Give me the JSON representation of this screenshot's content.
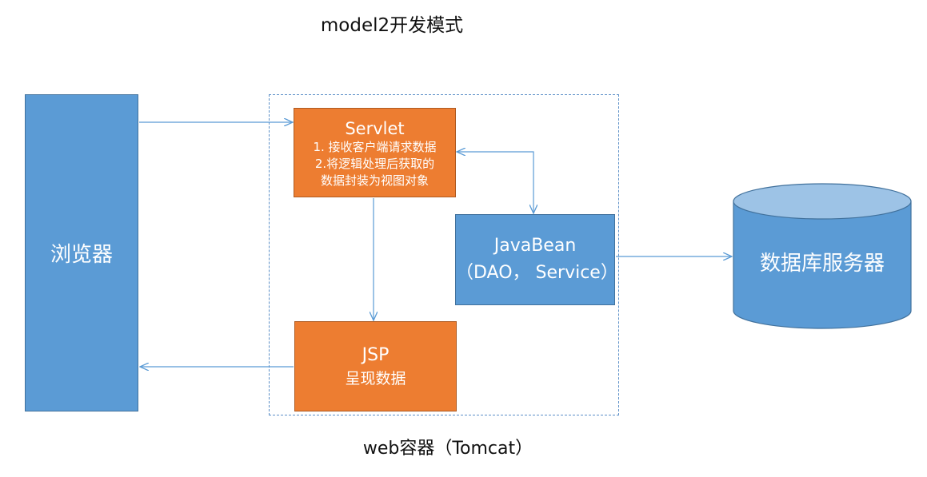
{
  "title": "model2开发模式",
  "container_label": "web容器（Tomcat）",
  "browser": {
    "label": "浏览器"
  },
  "servlet": {
    "title": "Servlet",
    "lines": [
      "1. 接收客户端请求数据",
      "2.将逻辑处理后获取的",
      "数据封装为视图对象"
    ]
  },
  "javabean": {
    "title": "JavaBean",
    "subtitle": "（DAO， Service）"
  },
  "jsp": {
    "title": "JSP",
    "subtitle": "呈现数据"
  },
  "database": {
    "label": "数据库服务器"
  },
  "colors": {
    "blue": "#5b9bd5",
    "orange": "#ed7d31",
    "arrow": "#5b9bd5"
  }
}
